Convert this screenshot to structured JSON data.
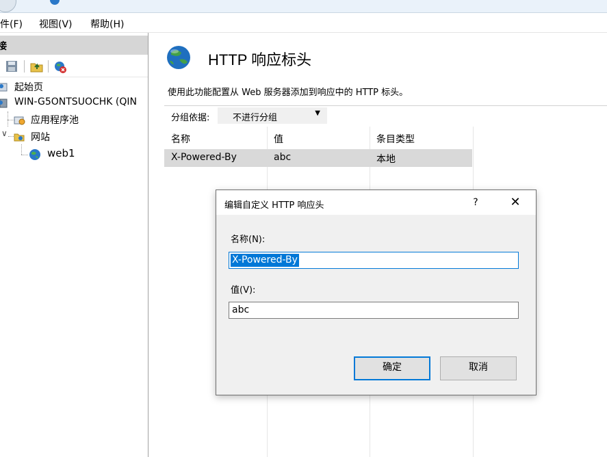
{
  "menu": {
    "file": "件(F)",
    "view": "视图(V)",
    "help": "帮助(H)"
  },
  "connections": {
    "header": "接",
    "tree": {
      "start_page": "起始页",
      "server": "WIN-G5ONTSUOCHK (QIN",
      "app_pools": "应用程序池",
      "sites": "网站",
      "site": "web1"
    }
  },
  "feature": {
    "title": "HTTP 响应标头",
    "description": "使用此功能配置从 Web 服务器添加到响应中的 HTTP 标头。",
    "group_by_label": "分组依据:",
    "group_by_value": "不进行分组"
  },
  "table": {
    "columns": [
      "名称",
      "值",
      "条目类型"
    ],
    "rows": [
      {
        "name": "X-Powered-By",
        "value": "abc",
        "type": "本地"
      }
    ]
  },
  "dialog": {
    "title": "编辑自定义 HTTP 响应头",
    "help": "?",
    "close": "✕",
    "name_label": "名称(N):",
    "name_value": "X-Powered-By",
    "value_label": "值(V):",
    "value_value": "abc",
    "ok": "确定",
    "cancel": "取消"
  },
  "colors": {
    "accent": "#0078d7",
    "selected_row": "#d9d9d9",
    "dialog_bg": "#f0f0f0"
  }
}
